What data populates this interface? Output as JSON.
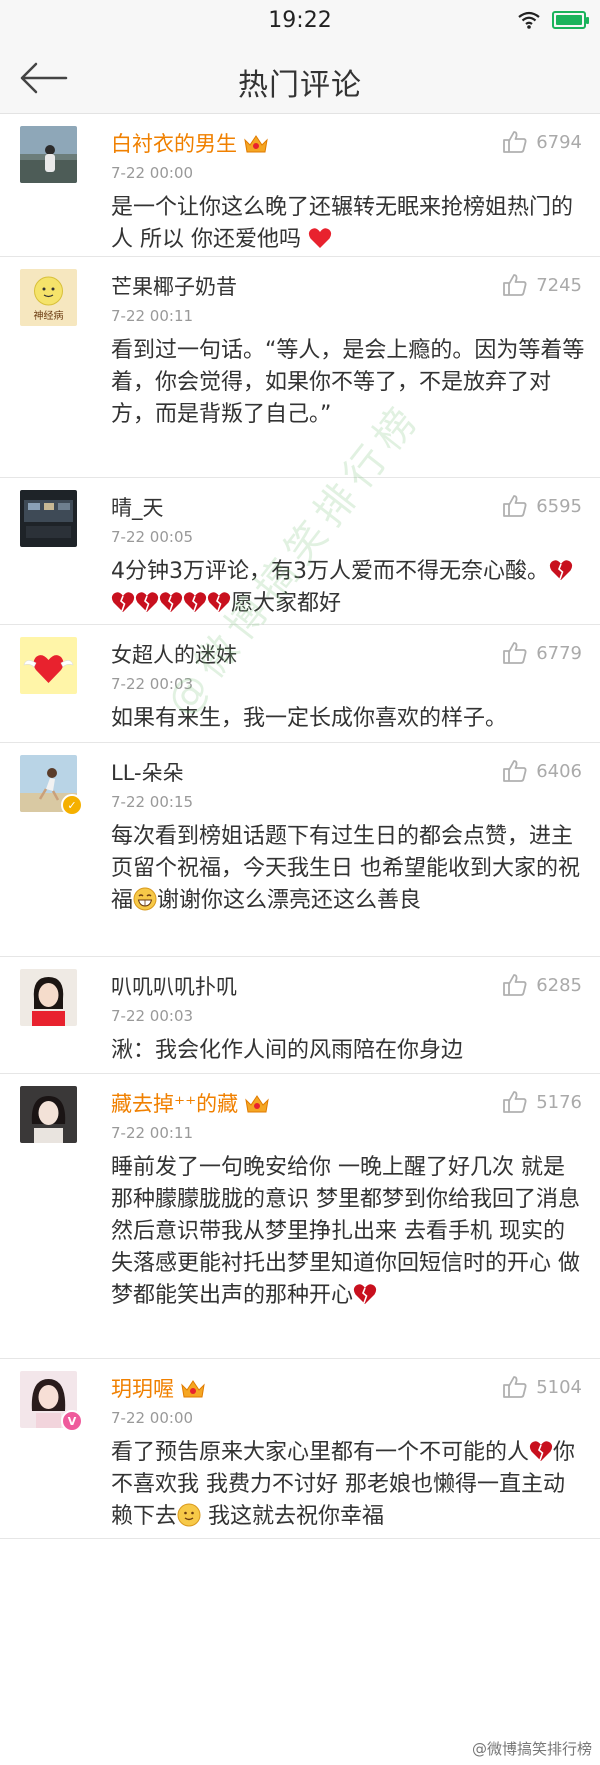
{
  "status": {
    "time": "19:22"
  },
  "nav": {
    "title": "热门评论"
  },
  "comments": [
    {
      "username": "白衬衣的男生",
      "vip": true,
      "time": "7-22 00:00",
      "likes": "6794",
      "content": "是一个让你这么晚了还辗转无眠来抢榜姐热门的人  所以 你还爱他吗"
    },
    {
      "username": "芒果椰子奶昔",
      "vip": false,
      "time": "7-22 00:11",
      "likes": "7245",
      "content": "看到过一句话。“等人，是会上瘾的。因为等着等着，你会觉得，如果你不等了，不是放弃了对方，而是背叛了自己。”"
    },
    {
      "username": "晴_天",
      "vip": false,
      "time": "7-22 00:05",
      "likes": "6595",
      "content_pre": "4分钟3万评论，有3万人爱而不得无奈心酸。",
      "content_post": "愿大家都好"
    },
    {
      "username": "女超人的迷妹",
      "vip": false,
      "time": "7-22 00:03",
      "likes": "6779",
      "content": "如果有来生，我一定长成你喜欢的样子。"
    },
    {
      "username": "LL-朵朵",
      "vip": false,
      "time": "7-22 00:15",
      "likes": "6406",
      "content_pre": "每次看到榜姐话题下有过生日的都会点赞，进主页留个祝福，今天我生日 也希望能收到大家的祝福",
      "content_post": "谢谢你这么漂亮还这么善良"
    },
    {
      "username": "叭叽叭叽扑叽",
      "vip": false,
      "time": "7-22 00:03",
      "likes": "6285",
      "content": "湫：我会化作人间的风雨陪在你身边"
    },
    {
      "username": "藏去掉⁺⁺的藏",
      "vip": true,
      "time": "7-22 00:11",
      "likes": "5176",
      "content": "睡前发了一句晚安给你 一晚上醒了好几次 就是那种朦朦胧胧的意识 梦里都梦到你给我回了消息 然后意识带我从梦里挣扎出来 去看手机 现实的失落感更能衬托出梦里知道你回短信时的开心 做梦都能笑出声的那种开心"
    },
    {
      "username": "玥玥喔",
      "vip": true,
      "time": "7-22 00:00",
      "likes": "5104",
      "content_pre": "看了预告原来大家心里都有一个不可能的人",
      "content_mid": "你不喜欢我  我费力不讨好  那老娘也懒得一直主动赖下去",
      "content_post": "  我这就去祝你幸福"
    }
  ],
  "avatar_text": {
    "mango": "神经病"
  },
  "watermark": {
    "diagonal": "@微博搞笑排行榜",
    "corner": "@微博搞笑排行榜"
  },
  "colors": {
    "vip_name": "#f08000",
    "battery": "#1ab35c",
    "heart": "#e8222e"
  }
}
